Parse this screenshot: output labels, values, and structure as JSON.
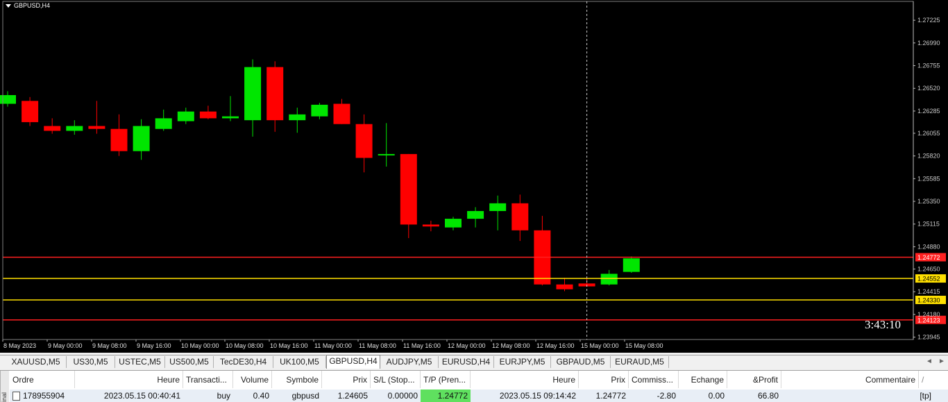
{
  "window": {
    "symbol_title": "GBPUSD,H4",
    "countdown": "3:43:10"
  },
  "colors": {
    "bull": "#00e600",
    "bear": "#ff0000",
    "background": "#000000",
    "tp_line": "#ff2020",
    "sl_line": "#ffe000",
    "tp_cell": "#5fe05f"
  },
  "chart_data": {
    "type": "candlestick",
    "symbol": "GBPUSD",
    "timeframe": "H4",
    "y_ticks": [
      "1.27225",
      "1.26990",
      "1.26755",
      "1.26520",
      "1.26285",
      "1.26055",
      "1.25820",
      "1.25585",
      "1.25350",
      "1.25115",
      "1.24880",
      "1.24650",
      "1.24415",
      "1.24180",
      "1.23945"
    ],
    "ylim": [
      1.2392,
      1.2742
    ],
    "x_ticks": [
      "8 May 2023",
      "9 May 00:00",
      "9 May 08:00",
      "9 May 16:00",
      "10 May 00:00",
      "10 May 08:00",
      "10 May 16:00",
      "11 May 00:00",
      "11 May 08:00",
      "11 May 16:00",
      "12 May 00:00",
      "12 May 08:00",
      "12 May 16:00",
      "15 May 00:00",
      "15 May 08:00"
    ],
    "candles": [
      {
        "o": 1.2636,
        "h": 1.2649,
        "l": 1.2633,
        "c": 1.2645
      },
      {
        "o": 1.2639,
        "h": 1.2643,
        "l": 1.2613,
        "c": 1.2617
      },
      {
        "o": 1.2613,
        "h": 1.2621,
        "l": 1.2605,
        "c": 1.2608
      },
      {
        "o": 1.2608,
        "h": 1.2619,
        "l": 1.2604,
        "c": 1.2613
      },
      {
        "o": 1.2613,
        "h": 1.2639,
        "l": 1.2605,
        "c": 1.261
      },
      {
        "o": 1.261,
        "h": 1.2625,
        "l": 1.2582,
        "c": 1.2587
      },
      {
        "o": 1.2587,
        "h": 1.262,
        "l": 1.2578,
        "c": 1.2613
      },
      {
        "o": 1.261,
        "h": 1.263,
        "l": 1.2608,
        "c": 1.2621
      },
      {
        "o": 1.2618,
        "h": 1.2632,
        "l": 1.2615,
        "c": 1.2628
      },
      {
        "o": 1.2628,
        "h": 1.2634,
        "l": 1.262,
        "c": 1.2621
      },
      {
        "o": 1.2621,
        "h": 1.2644,
        "l": 1.2618,
        "c": 1.2623
      },
      {
        "o": 1.2619,
        "h": 1.2682,
        "l": 1.2602,
        "c": 1.2674
      },
      {
        "o": 1.2674,
        "h": 1.268,
        "l": 1.2607,
        "c": 1.2619
      },
      {
        "o": 1.2619,
        "h": 1.2632,
        "l": 1.2606,
        "c": 1.2625
      },
      {
        "o": 1.2623,
        "h": 1.2637,
        "l": 1.262,
        "c": 1.2635
      },
      {
        "o": 1.2636,
        "h": 1.2641,
        "l": 1.2615,
        "c": 1.2615
      },
      {
        "o": 1.2615,
        "h": 1.2625,
        "l": 1.2565,
        "c": 1.258
      },
      {
        "o": 1.2583,
        "h": 1.2616,
        "l": 1.2571,
        "c": 1.2584
      },
      {
        "o": 1.2584,
        "h": 1.2584,
        "l": 1.2497,
        "c": 1.2511
      },
      {
        "o": 1.2511,
        "h": 1.2515,
        "l": 1.2504,
        "c": 1.2509
      },
      {
        "o": 1.2508,
        "h": 1.2519,
        "l": 1.2505,
        "c": 1.2517
      },
      {
        "o": 1.2517,
        "h": 1.2529,
        "l": 1.2508,
        "c": 1.2525
      },
      {
        "o": 1.2525,
        "h": 1.2541,
        "l": 1.2505,
        "c": 1.2533
      },
      {
        "o": 1.2533,
        "h": 1.2542,
        "l": 1.2494,
        "c": 1.2505
      },
      {
        "o": 1.2505,
        "h": 1.252,
        "l": 1.2448,
        "c": 1.2449
      },
      {
        "o": 1.2449,
        "h": 1.2456,
        "l": 1.2442,
        "c": 1.2444
      },
      {
        "o": 1.245,
        "h": 1.2456,
        "l": 1.2447,
        "c": 1.2447
      },
      {
        "o": 1.2449,
        "h": 1.2464,
        "l": 1.2448,
        "c": 1.246
      },
      {
        "o": 1.2462,
        "h": 1.2478,
        "l": 1.2461,
        "c": 1.2476
      }
    ],
    "levels": [
      {
        "label": "1.24772",
        "value": 1.24772,
        "kind": "tp"
      },
      {
        "label": "1.24552",
        "value": 1.24552,
        "kind": "sl"
      },
      {
        "label": "1.24330",
        "value": 1.2433,
        "kind": "sl"
      },
      {
        "label": "1.24123",
        "value": 1.24123,
        "kind": "tp"
      }
    ],
    "crosshair_candle_index": 26,
    "grid": false
  },
  "tabs": {
    "items": [
      {
        "label": "XAUUSD,M5"
      },
      {
        "label": "US30,M5"
      },
      {
        "label": "USTEC,M5"
      },
      {
        "label": "US500,M5"
      },
      {
        "label": "TecDE30,H4"
      },
      {
        "label": "UK100,M5"
      },
      {
        "label": "GBPUSD,H4"
      },
      {
        "label": "AUDJPY,M5"
      },
      {
        "label": "EURUSD,H4"
      },
      {
        "label": "EURJPY,M5"
      },
      {
        "label": "GBPAUD,M5"
      },
      {
        "label": "EURAUD,M5"
      }
    ],
    "active_index": 6,
    "scroll_left_icon": "◄",
    "scroll_right_icon": "►"
  },
  "terminal": {
    "side_label": "inal",
    "columns": [
      "Ordre",
      "Heure",
      "Transacti...",
      "Volume",
      "Symbole",
      "Prix",
      "S/L (Stop...",
      "T/P (Pren...",
      "Heure",
      "Prix",
      "Commiss...",
      "Echange",
      "&Profit",
      "Commentaire"
    ],
    "sort_icon": "/",
    "row": {
      "ordre": "178955904",
      "heure": "2023.05.15 00:40:41",
      "transaction": "buy",
      "volume": "0.40",
      "symbole": "gbpusd",
      "prix": "1.24605",
      "sl": "0.00000",
      "tp": "1.24772",
      "heure2": "2023.05.15 09:14:42",
      "prix2": "1.24772",
      "commission": "-2.80",
      "echange": "0.00",
      "profit": "66.80",
      "commentaire": "[tp]"
    }
  }
}
